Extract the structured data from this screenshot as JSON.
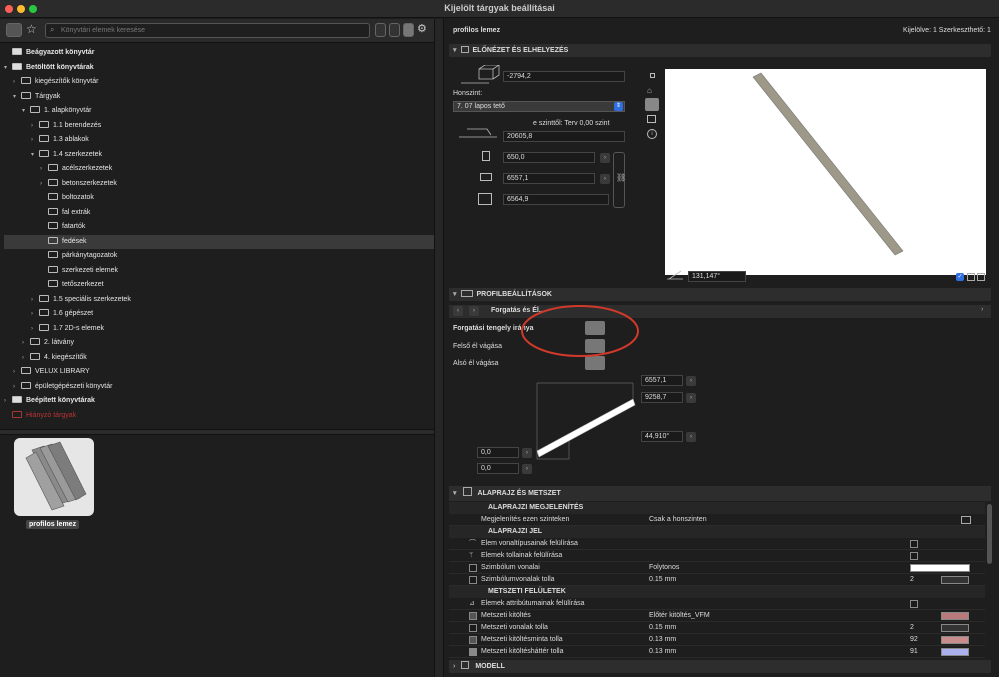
{
  "window": {
    "title": "Kijelölt tárgyak beállításai"
  },
  "library": {
    "search_placeholder": "Könyvtári elemek keresése",
    "tree": [
      {
        "label": "Beágyazott könyvtár",
        "depth": 0,
        "arrow": "",
        "bold": true
      },
      {
        "label": "Betöltött könyvtárak",
        "depth": 0,
        "arrow": "▾",
        "bold": true
      },
      {
        "label": "kiegészítők könyvtár",
        "depth": 1,
        "arrow": "›"
      },
      {
        "label": "Tárgyak",
        "depth": 1,
        "arrow": "▾"
      },
      {
        "label": "1. alapkönyvtár",
        "depth": 2,
        "arrow": "▾"
      },
      {
        "label": "1.1 berendezés",
        "depth": 3,
        "arrow": "›"
      },
      {
        "label": "1.3 ablakok",
        "depth": 3,
        "arrow": "›"
      },
      {
        "label": "1.4 szerkezetek",
        "depth": 3,
        "arrow": "▾"
      },
      {
        "label": "acélszerkezetek",
        "depth": 4,
        "arrow": "›"
      },
      {
        "label": "betonszerkezetek",
        "depth": 4,
        "arrow": "›"
      },
      {
        "label": "boltozatok",
        "depth": 4,
        "arrow": ""
      },
      {
        "label": "fal extrák",
        "depth": 4,
        "arrow": ""
      },
      {
        "label": "fatartók",
        "depth": 4,
        "arrow": ""
      },
      {
        "label": "fedések",
        "depth": 4,
        "arrow": "",
        "selected": true
      },
      {
        "label": "párkánytagozatok",
        "depth": 4,
        "arrow": ""
      },
      {
        "label": "szerkezeti elemek",
        "depth": 4,
        "arrow": ""
      },
      {
        "label": "tetőszerkezet",
        "depth": 4,
        "arrow": ""
      },
      {
        "label": "1.5 speciális szerkezetek",
        "depth": 3,
        "arrow": "›"
      },
      {
        "label": "1.6 gépészet",
        "depth": 3,
        "arrow": "›"
      },
      {
        "label": "1.7 2D-s elemek",
        "depth": 3,
        "arrow": "›"
      },
      {
        "label": "2. látvány",
        "depth": 2,
        "arrow": "›"
      },
      {
        "label": "4. kiegészítők",
        "depth": 2,
        "arrow": "›"
      },
      {
        "label": "VELUX LIBRARY",
        "depth": 1,
        "arrow": "›"
      },
      {
        "label": "épületgépészeti könyvtár",
        "depth": 1,
        "arrow": "›"
      },
      {
        "label": "Beépített könyvtárak",
        "depth": 0,
        "arrow": "›",
        "bold": true
      },
      {
        "label": "Hiányzó tárgyak",
        "depth": 0,
        "arrow": "",
        "missing": true
      }
    ],
    "preview_label": "profilos lemez"
  },
  "settings": {
    "object_name": "profilos lemez",
    "selection_info": "Kijelölve: 1 Szerkeszthető: 1",
    "preview_section": "ELŐNÉZET ÉS ELHELYEZÉS",
    "elevation": "-2794,2",
    "home_story_label": "Honszint:",
    "home_story": "7. 07 lapos tető",
    "from_story_label": "e szinttől: Terv 0,00 szint",
    "from_story_value": "20605,8",
    "dim_a": "650,0",
    "dim_b": "6557,1",
    "dim_c": "6564,9",
    "angle": "131,147°",
    "profile_section": "PROFILBEÁLLÍTÁSOK",
    "profile_page": "Forgatás és Él...",
    "rot_axis_label": "Forgatási tengely iránya",
    "top_cut_label": "Felső él vágása",
    "bottom_cut_label": "Alsó él vágása",
    "diag_length": "6557,1",
    "diag_hyp": "9258,7",
    "diag_angle": "44,910°",
    "diag_off1": "0,0",
    "diag_off2": "0,0",
    "plan_section": "ALAPRAJZ ÉS METSZET",
    "plan_display_header": "ALAPRAJZI MEGJELENÍTÉS",
    "show_on_label": "Megjelenítés ezen szinteken",
    "show_on_value": "Csak a honszinten",
    "plan_symbol_header": "ALAPRAJZI JEL",
    "row_linetype_override": "Elem vonaltípusainak felülírása",
    "row_pen_override": "Elemek tollainak felülírása",
    "row_symbol_lines": "Szimbólum vonalai",
    "row_symbol_lines_val": "Folytonos",
    "row_symbol_pen": "Szimbólumvonalak tolla",
    "row_symbol_pen_val": "0.15 mm",
    "row_symbol_pen_num": "2",
    "section_surface_header": "METSZETI FELÜLETEK",
    "row_attr_override": "Elemek attribútumainak felülírása",
    "row_cut_fill": "Metszeti kitöltés",
    "row_cut_fill_val": "Előtér kitöltés_VFM",
    "row_cut_line_pen": "Metszeti vonalak tolla",
    "row_cut_line_pen_val": "0.15 mm",
    "row_cut_line_pen_num": "2",
    "row_fill_pen": "Metszeti kitöltésminta tolla",
    "row_fill_pen_val": "0.13 mm",
    "row_fill_pen_num": "92",
    "row_bg_pen": "Metszeti kitöltésháttér tolla",
    "row_bg_pen_val": "0.13 mm",
    "row_bg_pen_num": "91",
    "model_section": "MODELL"
  }
}
